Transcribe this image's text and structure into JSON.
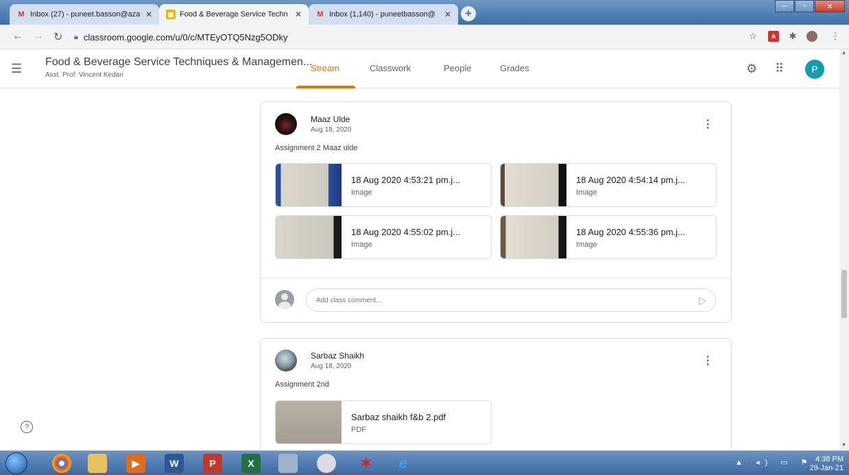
{
  "browser": {
    "tabs": [
      {
        "title": "Inbox (27) - puneet.basson@aza",
        "icon": "gmail-icon",
        "active": false
      },
      {
        "title": "Food & Beverage Service Techn",
        "icon": "classroom-icon",
        "active": true
      },
      {
        "title": "Inbox (1,140) - puneetbasson@",
        "icon": "gmail-icon",
        "active": false
      }
    ],
    "url": "classroom.google.com/u/0/c/MTEyOTQ5Nzg5ODky"
  },
  "header": {
    "course_title": "Food & Beverage Service Techniques & Managemen...",
    "course_subtitle": "Asst. Prof. Vincent Kedari",
    "tabs": [
      "Stream",
      "Classwork",
      "People",
      "Grades"
    ],
    "active_tab": "Stream",
    "user_initial": "P"
  },
  "posts": [
    {
      "author": "Maaz Ulde",
      "date": "Aug 18, 2020",
      "text": "Assignment 2 Maaz ulde",
      "attachments": [
        {
          "name": "18 Aug 2020 4:53:21 pm.j...",
          "type": "Image"
        },
        {
          "name": "18 Aug 2020 4:54:14 pm.j...",
          "type": "Image"
        },
        {
          "name": "18 Aug 2020 4:55:02 pm.j...",
          "type": "Image"
        },
        {
          "name": "18 Aug 2020 4:55:36 pm.j...",
          "type": "Image"
        }
      ],
      "comment_placeholder": "Add class comment..."
    },
    {
      "author": "Sarbaz Shaikh",
      "date": "Aug 18, 2020",
      "text": "Assignment 2nd",
      "attachments": [
        {
          "name": "Sarbaz shaikh f&b 2.pdf",
          "type": "PDF"
        }
      ]
    }
  ],
  "taskbar": {
    "time": "4:38 PM",
    "date": "29-Jan-21"
  },
  "colors": {
    "accent": "#e37400",
    "avatar": "#129eaf"
  }
}
